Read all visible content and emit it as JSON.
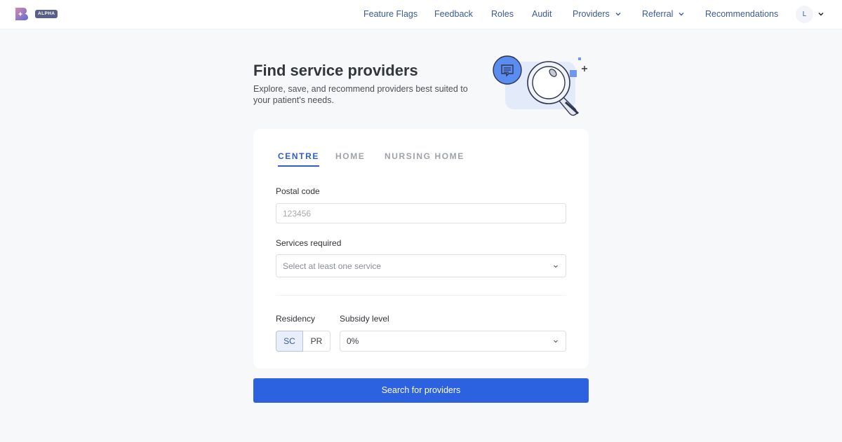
{
  "header": {
    "logo_alt": "B",
    "badge": "ALPHA",
    "nav": [
      {
        "label": "Feature Flags",
        "has_dropdown": false
      },
      {
        "label": "Feedback",
        "has_dropdown": false
      },
      {
        "label": "Roles",
        "has_dropdown": false
      },
      {
        "label": "Audit",
        "has_dropdown": false
      },
      {
        "label": "Providers",
        "has_dropdown": true
      },
      {
        "label": "Referral",
        "has_dropdown": true
      },
      {
        "label": "Recommendations",
        "has_dropdown": false
      }
    ],
    "user_initial": "L"
  },
  "hero": {
    "title": "Find service providers",
    "subtitle": "Explore, save, and recommend providers best suited to your patient's needs.",
    "illustration": "magnifying-glass-chat-illustration"
  },
  "tabs": [
    {
      "label": "CENTRE",
      "active": true
    },
    {
      "label": "HOME",
      "active": false
    },
    {
      "label": "NURSING HOME",
      "active": false
    }
  ],
  "form": {
    "postal_code": {
      "label": "Postal code",
      "placeholder": "123456",
      "value": ""
    },
    "services": {
      "label": "Services required",
      "placeholder": "Select at least one service"
    },
    "residency": {
      "label": "Residency",
      "options": [
        "SC",
        "PR"
      ],
      "selected": "SC"
    },
    "subsidy": {
      "label": "Subsidy level",
      "value": "0%"
    }
  },
  "actions": {
    "search_label": "Search for providers"
  },
  "colors": {
    "primary": "#2c62e0",
    "nav_text": "#3a5a99",
    "tab_active": "#2f5fc4",
    "badge": "#5a5f85"
  }
}
